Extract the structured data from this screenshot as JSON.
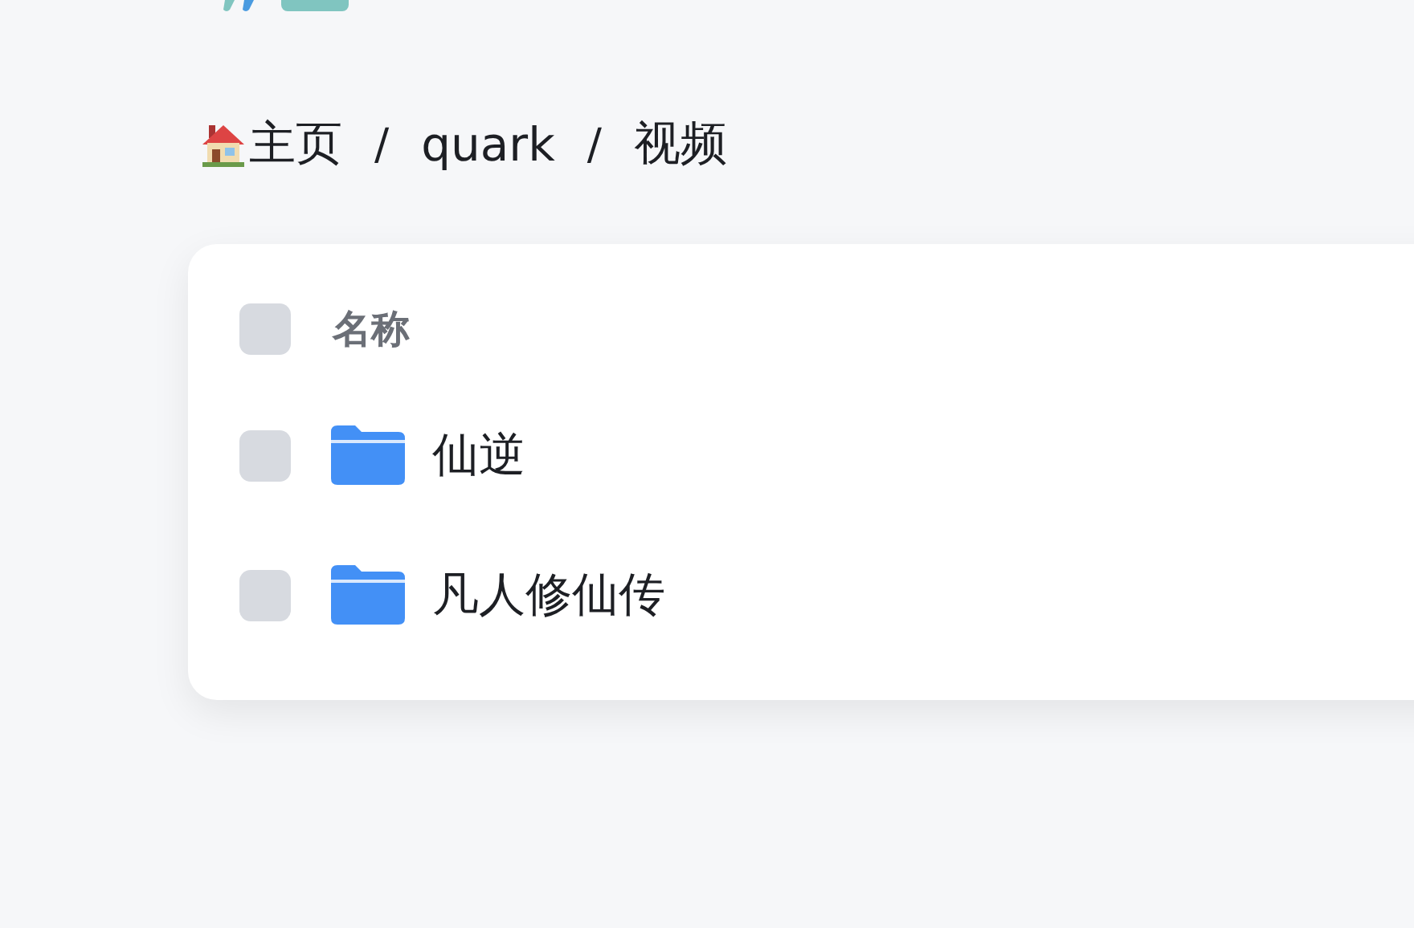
{
  "breadcrumb": [
    {
      "kind": "home",
      "label": "主页"
    },
    {
      "kind": "folder",
      "label": "quark"
    },
    {
      "kind": "folder",
      "label": "视频"
    }
  ],
  "separator": "/",
  "table": {
    "header": {
      "label": "名称",
      "checked": false
    },
    "rows": [
      {
        "kind": "folder",
        "name": "仙逆",
        "checked": false
      },
      {
        "kind": "folder",
        "name": "凡人修仙传",
        "checked": false
      }
    ]
  }
}
